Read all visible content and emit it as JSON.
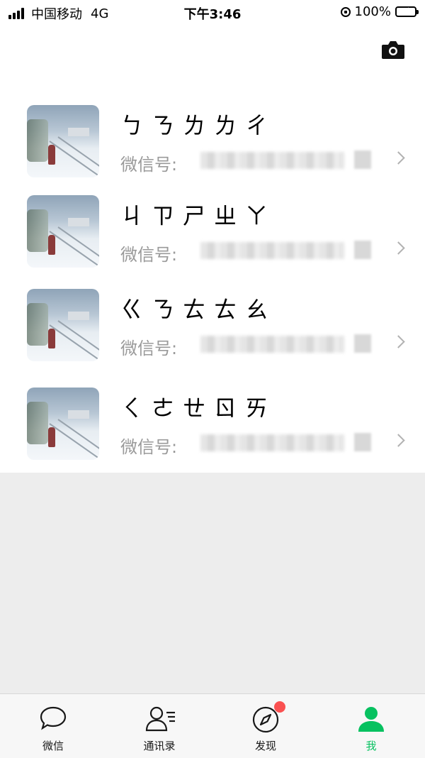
{
  "status_bar": {
    "carrier": "中国移动",
    "network": "4G",
    "time": "下午3:46",
    "battery": "100%"
  },
  "accounts": [
    {
      "name": "ㄅㄋㄌㄌㄔ",
      "id_label": "微信号:"
    },
    {
      "name": "ㄐㄗㄕㄓㄚ",
      "id_label": "微信号:"
    },
    {
      "name": "ㄍㄋㄊㄊㄠ",
      "id_label": "微信号:"
    },
    {
      "name": "ㄑㄜㄝㄖㄞ",
      "id_label": "微信号:"
    }
  ],
  "tabs": [
    {
      "label": "微信",
      "icon": "chat-bubble-icon"
    },
    {
      "label": "通讯录",
      "icon": "contacts-icon"
    },
    {
      "label": "发现",
      "icon": "compass-icon"
    },
    {
      "label": "我",
      "icon": "person-icon"
    }
  ],
  "colors": {
    "accent": "#07c160",
    "badge": "#fa5151",
    "background": "#ededed"
  }
}
